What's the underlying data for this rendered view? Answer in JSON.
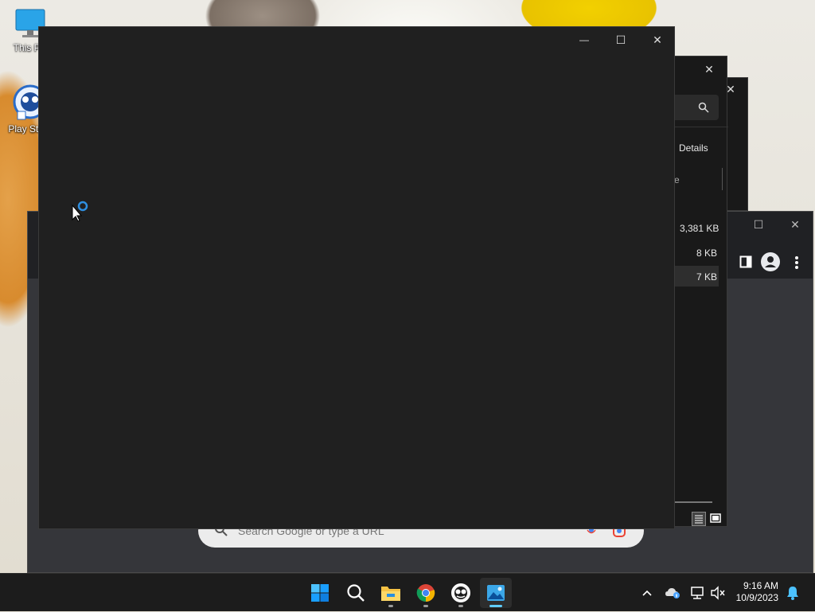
{
  "desktop": {
    "icons": [
      {
        "label": "This PC",
        "icon": "monitor-icon"
      },
      {
        "label": "Play Store",
        "icon": "app-icon"
      }
    ]
  },
  "explorer": {
    "details_label": "Details",
    "column_fragment": "e",
    "file_sizes": [
      "3,381 KB",
      "8 KB",
      "7 KB"
    ]
  },
  "browser": {
    "search_placeholder": "Search Google or type a URL"
  },
  "main_window": {
    "state": "loading",
    "controls": {
      "minimize": "—",
      "maximize": "☐",
      "close": "✕"
    }
  },
  "taskbar": {
    "apps": [
      "start-icon",
      "search-icon",
      "file-explorer-icon",
      "chrome-icon",
      "play-store-icon",
      "photos-icon"
    ],
    "active_app": "photos-icon",
    "time": "9:16 AM",
    "date": "10/9/2023"
  },
  "colors": {
    "window_bg": "#202020",
    "accent": "#60cdff",
    "taskbar_bg": "#1c1c1c"
  }
}
